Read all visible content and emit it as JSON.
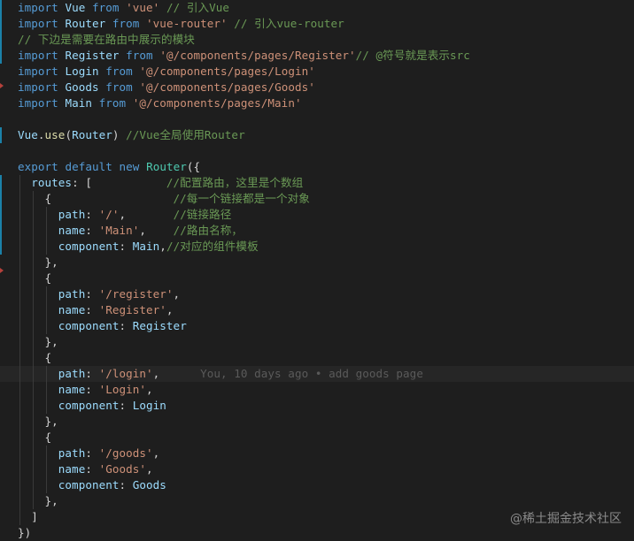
{
  "lines": [
    [
      [
        "import",
        "kw"
      ],
      [
        " ",
        "punc"
      ],
      [
        "Vue",
        "id"
      ],
      [
        " ",
        "punc"
      ],
      [
        "from",
        "kw"
      ],
      [
        " ",
        "punc"
      ],
      [
        "'vue'",
        "str"
      ],
      [
        " ",
        "punc"
      ],
      [
        "// 引入Vue",
        "cmt"
      ]
    ],
    [
      [
        "import",
        "kw"
      ],
      [
        " ",
        "punc"
      ],
      [
        "Router",
        "id"
      ],
      [
        " ",
        "punc"
      ],
      [
        "from",
        "kw"
      ],
      [
        " ",
        "punc"
      ],
      [
        "'vue-router'",
        "str"
      ],
      [
        " ",
        "punc"
      ],
      [
        "// 引入vue-router",
        "cmt"
      ]
    ],
    [
      [
        "// 下边是需要在路由中展示的模块",
        "cmt"
      ]
    ],
    [
      [
        "import",
        "kw"
      ],
      [
        " ",
        "punc"
      ],
      [
        "Register",
        "id"
      ],
      [
        " ",
        "punc"
      ],
      [
        "from",
        "kw"
      ],
      [
        " ",
        "punc"
      ],
      [
        "'@/components/pages/Register'",
        "str"
      ],
      [
        "// @符号就是表示src",
        "cmt"
      ]
    ],
    [
      [
        "import",
        "kw"
      ],
      [
        " ",
        "punc"
      ],
      [
        "Login",
        "id"
      ],
      [
        " ",
        "punc"
      ],
      [
        "from",
        "kw"
      ],
      [
        " ",
        "punc"
      ],
      [
        "'@/components/pages/Login'",
        "str"
      ]
    ],
    [
      [
        "import",
        "kw"
      ],
      [
        " ",
        "punc"
      ],
      [
        "Goods",
        "id"
      ],
      [
        " ",
        "punc"
      ],
      [
        "from",
        "kw"
      ],
      [
        " ",
        "punc"
      ],
      [
        "'@/components/pages/Goods'",
        "str"
      ]
    ],
    [
      [
        "import",
        "kw"
      ],
      [
        " ",
        "punc"
      ],
      [
        "Main",
        "id"
      ],
      [
        " ",
        "punc"
      ],
      [
        "from",
        "kw"
      ],
      [
        " ",
        "punc"
      ],
      [
        "'@/components/pages/Main'",
        "str"
      ]
    ],
    [],
    [
      [
        "Vue",
        "id"
      ],
      [
        ".",
        "punc"
      ],
      [
        "use",
        "fn"
      ],
      [
        "(",
        "punc"
      ],
      [
        "Router",
        "id"
      ],
      [
        ")",
        "punc"
      ],
      [
        " ",
        "punc"
      ],
      [
        "//Vue全局使用Router",
        "cmt"
      ]
    ],
    [],
    [
      [
        "export",
        "kw"
      ],
      [
        " ",
        "punc"
      ],
      [
        "default",
        "kw"
      ],
      [
        " ",
        "punc"
      ],
      [
        "new",
        "kw"
      ],
      [
        " ",
        "punc"
      ],
      [
        "Router",
        "cls"
      ],
      [
        "({",
        "punc"
      ]
    ],
    [
      [
        "  ",
        "punc"
      ],
      [
        "routes",
        "id"
      ],
      [
        ": [           ",
        "punc"
      ],
      [
        "//配置路由，这里是个数组",
        "cmt"
      ]
    ],
    [
      [
        "    {                  ",
        "punc"
      ],
      [
        "//每一个链接都是一个对象",
        "cmt"
      ]
    ],
    [
      [
        "      ",
        "punc"
      ],
      [
        "path",
        "id"
      ],
      [
        ": ",
        "punc"
      ],
      [
        "'/'",
        "str"
      ],
      [
        ",       ",
        "punc"
      ],
      [
        "//链接路径",
        "cmt"
      ]
    ],
    [
      [
        "      ",
        "punc"
      ],
      [
        "name",
        "id"
      ],
      [
        ": ",
        "punc"
      ],
      [
        "'Main'",
        "str"
      ],
      [
        ",    ",
        "punc"
      ],
      [
        "//路由名称，",
        "cmt"
      ]
    ],
    [
      [
        "      ",
        "punc"
      ],
      [
        "component",
        "id"
      ],
      [
        ": ",
        "punc"
      ],
      [
        "Main",
        "id"
      ],
      [
        ",",
        "punc"
      ],
      [
        "//对应的组件模板",
        "cmt"
      ]
    ],
    [
      [
        "    },",
        "punc"
      ]
    ],
    [
      [
        "    {",
        "punc"
      ]
    ],
    [
      [
        "      ",
        "punc"
      ],
      [
        "path",
        "id"
      ],
      [
        ": ",
        "punc"
      ],
      [
        "'/register'",
        "str"
      ],
      [
        ",",
        "punc"
      ]
    ],
    [
      [
        "      ",
        "punc"
      ],
      [
        "name",
        "id"
      ],
      [
        ": ",
        "punc"
      ],
      [
        "'Register'",
        "str"
      ],
      [
        ",",
        "punc"
      ]
    ],
    [
      [
        "      ",
        "punc"
      ],
      [
        "component",
        "id"
      ],
      [
        ": ",
        "punc"
      ],
      [
        "Register",
        "id"
      ]
    ],
    [
      [
        "    },",
        "punc"
      ]
    ],
    [
      [
        "    {",
        "punc"
      ]
    ],
    [
      [
        "      ",
        "punc"
      ],
      [
        "path",
        "id"
      ],
      [
        ": ",
        "punc"
      ],
      [
        "'/login'",
        "str"
      ],
      [
        ",",
        "punc"
      ],
      [
        "      You, 10 days ago • add goods page",
        "blame"
      ]
    ],
    [
      [
        "      ",
        "punc"
      ],
      [
        "name",
        "id"
      ],
      [
        ": ",
        "punc"
      ],
      [
        "'Login'",
        "str"
      ],
      [
        ",",
        "punc"
      ]
    ],
    [
      [
        "      ",
        "punc"
      ],
      [
        "component",
        "id"
      ],
      [
        ": ",
        "punc"
      ],
      [
        "Login",
        "id"
      ]
    ],
    [
      [
        "    },",
        "punc"
      ]
    ],
    [
      [
        "    {",
        "punc"
      ]
    ],
    [
      [
        "      ",
        "punc"
      ],
      [
        "path",
        "id"
      ],
      [
        ": ",
        "punc"
      ],
      [
        "'/goods'",
        "str"
      ],
      [
        ",",
        "punc"
      ]
    ],
    [
      [
        "      ",
        "punc"
      ],
      [
        "name",
        "id"
      ],
      [
        ": ",
        "punc"
      ],
      [
        "'Goods'",
        "str"
      ],
      [
        ",",
        "punc"
      ]
    ],
    [
      [
        "      ",
        "punc"
      ],
      [
        "component",
        "id"
      ],
      [
        ": ",
        "punc"
      ],
      [
        "Goods",
        "id"
      ]
    ],
    [
      [
        "    },",
        "punc"
      ]
    ],
    [
      [
        "  ]",
        "punc"
      ]
    ],
    [
      [
        "})",
        "punc"
      ]
    ]
  ],
  "current_line": 23,
  "colors": {
    "background": "#1e1e1e",
    "keyword": "#569cd6",
    "identifier": "#9cdcfe",
    "string": "#ce9178",
    "comment": "#6a9955",
    "class": "#4ec9b0",
    "function": "#dcdcaa",
    "git_added": "#1b81a8",
    "git_deleted": "#b5413b"
  },
  "watermark": "@稀土掘金技术社区"
}
